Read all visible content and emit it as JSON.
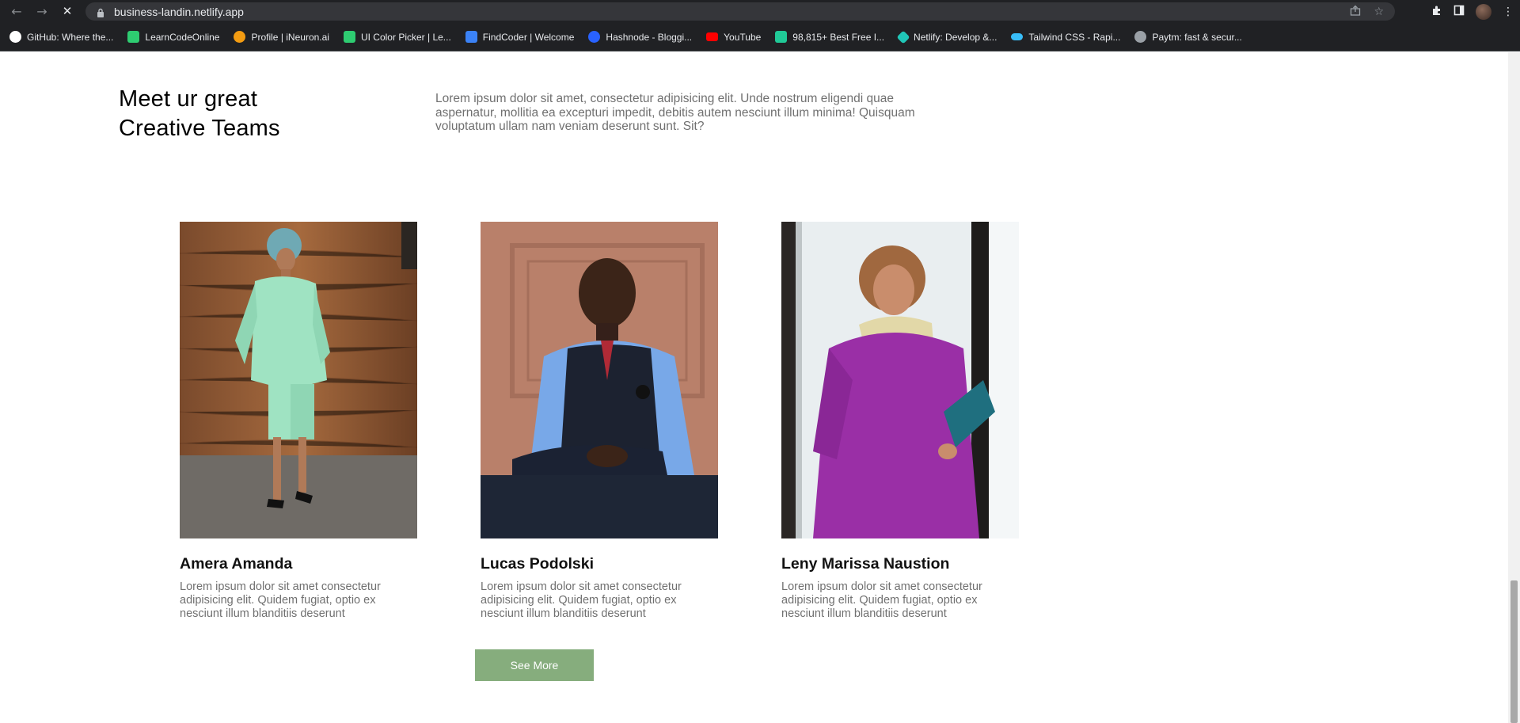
{
  "browser": {
    "url": "business-landin.netlify.app",
    "bookmarks": [
      {
        "label": "GitHub: Where the...",
        "color": "#ffffff"
      },
      {
        "label": "LearnCodeOnline",
        "color": "#2ecc71"
      },
      {
        "label": "Profile | iNeuron.ai",
        "color": "#f39c12"
      },
      {
        "label": "UI Color Picker | Le...",
        "color": "#2ecc71"
      },
      {
        "label": "FindCoder | Welcome",
        "color": "#3b82f6"
      },
      {
        "label": "Hashnode - Bloggi...",
        "color": "#2962ff"
      },
      {
        "label": "YouTube",
        "color": "#ff0000"
      },
      {
        "label": "98,815+ Best Free I...",
        "color": "#20c997"
      },
      {
        "label": "Netlify: Develop &...",
        "color": "#20c6b7"
      },
      {
        "label": "Tailwind CSS - Rapi...",
        "color": "#38bdf8"
      },
      {
        "label": "Paytm: fast & secur...",
        "color": "#9aa0a6"
      }
    ]
  },
  "section": {
    "title_line1": "Meet ur great",
    "title_line2": "Creative Teams",
    "description": "Lorem ipsum dolor sit amet, consectetur adipisicing elit. Unde nostrum eligendi quae aspernatur, mollitia ea excepturi impedit, debitis autem nesciunt illum minima! Quisquam voluptatum ullam nam veniam deserunt sunt. Sit?"
  },
  "team": [
    {
      "name": "Amera Amanda",
      "bio": "Lorem ipsum dolor sit amet consectetur adipisicing elit. Quidem fugiat, optio ex nesciunt illum blanditiis deserunt"
    },
    {
      "name": "Lucas Podolski",
      "bio": "Lorem ipsum dolor sit amet consectetur adipisicing elit. Quidem fugiat, optio ex nesciunt illum blanditiis deserunt"
    },
    {
      "name": "Leny Marissa Naustion",
      "bio": "Lorem ipsum dolor sit amet consectetur adipisicing elit. Quidem fugiat, optio ex nesciunt illum blanditiis deserunt"
    }
  ],
  "cta": {
    "label": "See More",
    "color": "#86ad7d"
  }
}
